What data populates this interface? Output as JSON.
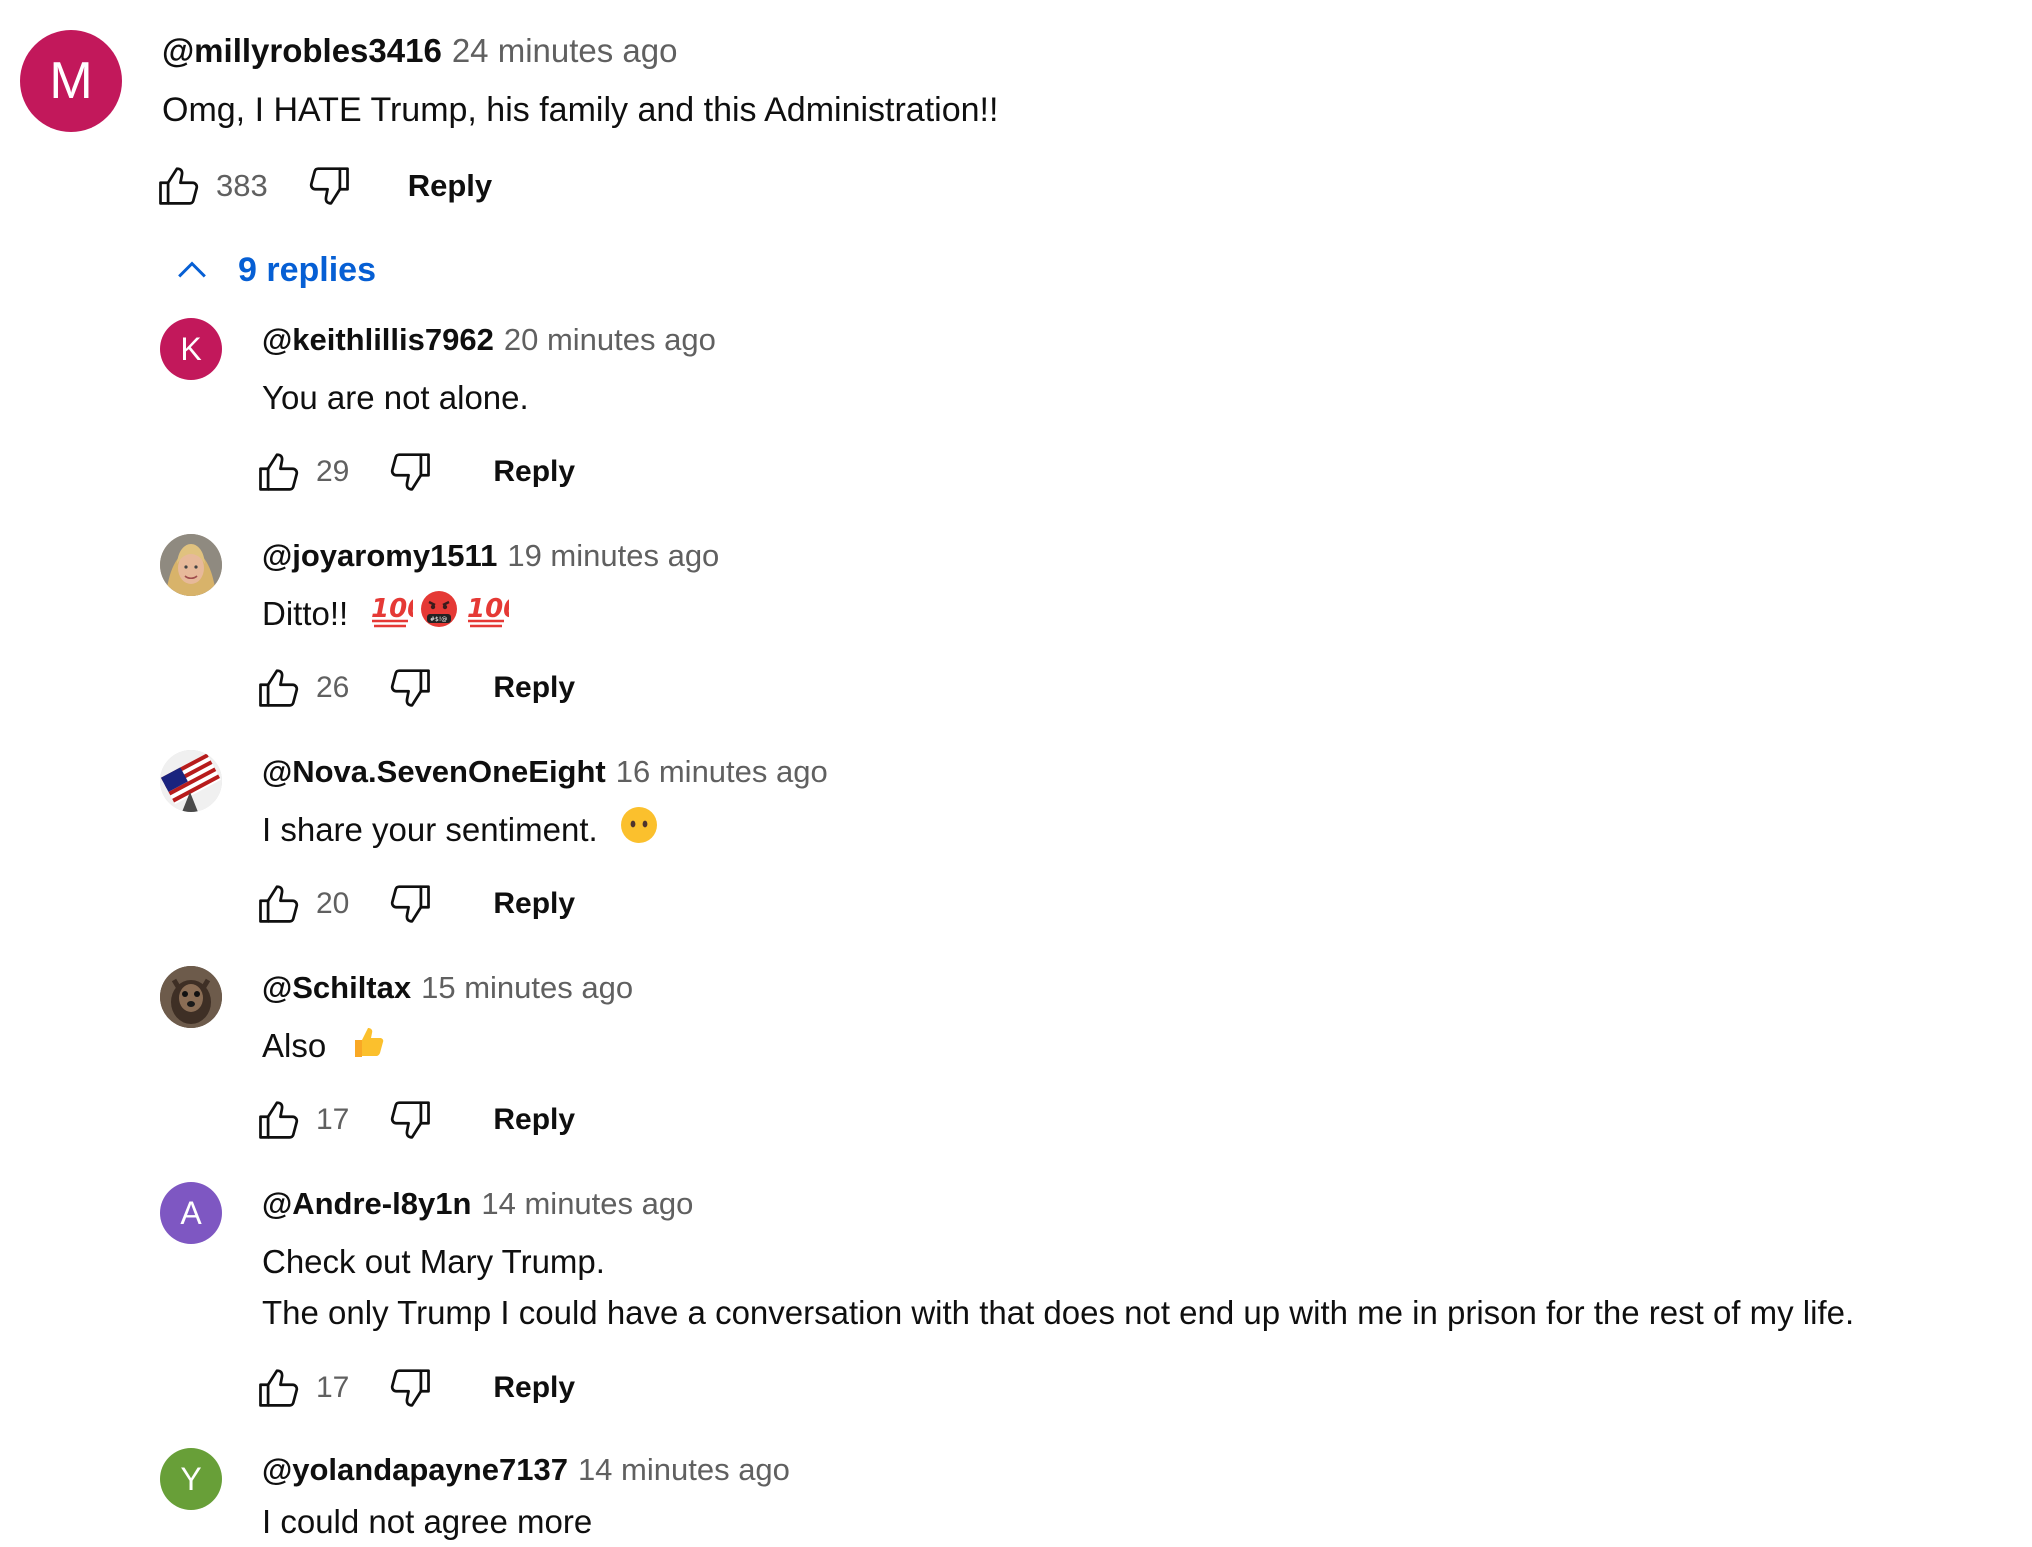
{
  "top_comment": {
    "author": "@millyrobles3416",
    "time": "24 minutes ago",
    "text_lines": [
      "Omg, I HATE Trump, his family and this Administration!!"
    ],
    "likes": "383",
    "avatar_letter": "M",
    "avatar_color": "#c2185b",
    "reply_label": "Reply"
  },
  "replies_toggle": {
    "label": "9 replies",
    "icon": "chevron-up-icon",
    "color": "#065fd4"
  },
  "replies": [
    {
      "author": "@keithlillis7962",
      "time": "20 minutes ago",
      "text_lines": [
        "You are not alone."
      ],
      "likes": "29",
      "avatar_letter": "K",
      "avatar_color": "#c2185b",
      "reply_label": "Reply"
    },
    {
      "author": "@joyaromy1511",
      "time": "19 minutes ago",
      "text_lines": [
        "Ditto!!"
      ],
      "emoji": [
        "hundred-points-icon",
        "cursing-face-icon",
        "hundred-points-icon"
      ],
      "likes": "26",
      "avatar_image": "woman-photo",
      "reply_label": "Reply"
    },
    {
      "author": "@Nova.SevenOneEight",
      "time": "16 minutes ago",
      "text_lines": [
        "I share your sentiment."
      ],
      "emoji": [
        "face-without-mouth-icon"
      ],
      "likes": "20",
      "avatar_image": "flag-photo",
      "reply_label": "Reply"
    },
    {
      "author": "@Schiltax",
      "time": "15 minutes ago",
      "text_lines": [
        "Also"
      ],
      "emoji": [
        "thumbs-up-emoji-icon"
      ],
      "likes": "17",
      "avatar_image": "animal-photo",
      "reply_label": "Reply"
    },
    {
      "author": "@Andre-l8y1n",
      "time": "14 minutes ago",
      "text_lines": [
        "Check out Mary Trump.",
        "The only Trump I could have a conversation with that does not end up with me in prison for the rest of my life."
      ],
      "likes": "17",
      "avatar_letter": "A",
      "avatar_color": "#7e57c2",
      "reply_label": "Reply"
    },
    {
      "author": "@yolandapayne7137",
      "time": "14 minutes ago",
      "text_lines": [
        "I could not agree more"
      ],
      "avatar_letter": "Y",
      "avatar_color": "#689f38"
    }
  ]
}
